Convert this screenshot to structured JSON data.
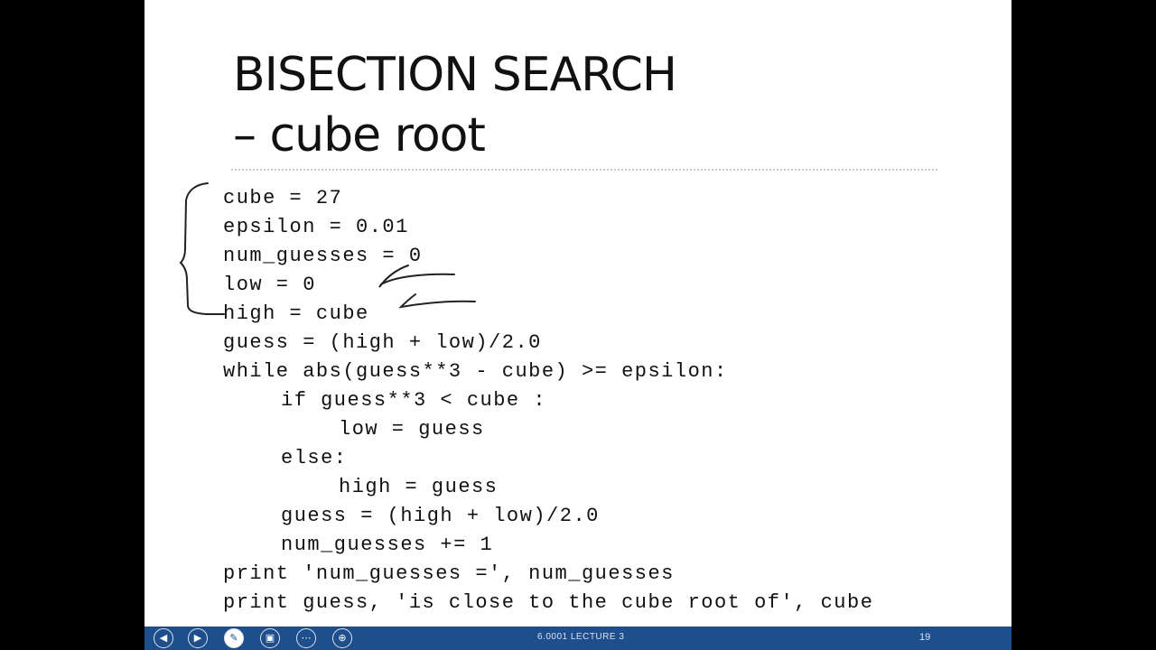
{
  "slide": {
    "title_line1": "BISECTION SEARCH",
    "title_line2": "– cube root",
    "code": [
      {
        "indent": 0,
        "text": "cube = 27"
      },
      {
        "indent": 0,
        "text": "epsilon = 0.01"
      },
      {
        "indent": 0,
        "text": "num_guesses = 0"
      },
      {
        "indent": 0,
        "text": "low = 0"
      },
      {
        "indent": 0,
        "text": "high = cube"
      },
      {
        "indent": 0,
        "text": "guess = (high + low)/2.0"
      },
      {
        "indent": 0,
        "text": "while abs(guess**3 - cube) >= epsilon:"
      },
      {
        "indent": 1,
        "text": "if guess**3 < cube :"
      },
      {
        "indent": 2,
        "text": "low = guess"
      },
      {
        "indent": 1,
        "text": "else:"
      },
      {
        "indent": 2,
        "text": "high = guess"
      },
      {
        "indent": 1,
        "text": "guess = (high + low)/2.0"
      },
      {
        "indent": 1,
        "text": "num_guesses += 1"
      },
      {
        "indent": 0,
        "text": "print 'num_guesses =', num_guesses"
      },
      {
        "indent": 0,
        "text": "print guess, 'is close to the cube root of', cube"
      }
    ]
  },
  "toolbar": {
    "icons": [
      "back-icon",
      "forward-icon",
      "pen-icon",
      "slides-icon",
      "more-icon",
      "zoom-icon"
    ],
    "footer_text": "6.0001 LECTURE 3",
    "page_number": "19"
  },
  "colors": {
    "slide_bg": "#ffffff",
    "page_bg": "#000000",
    "toolbar_bg": "#1f4e8c",
    "ink": "#222222"
  }
}
